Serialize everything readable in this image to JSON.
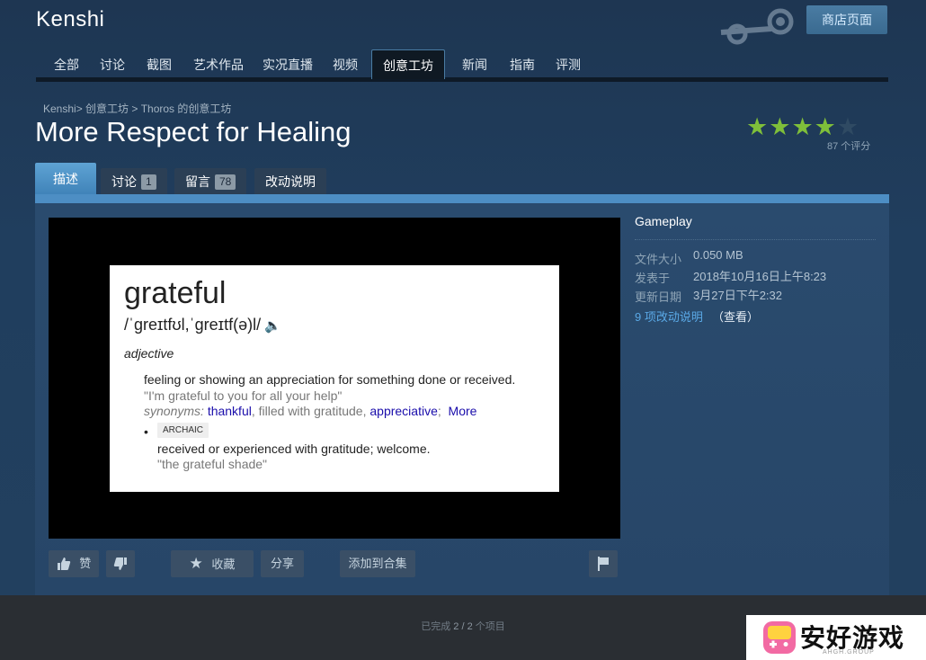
{
  "header": {
    "app_title": "Kenshi",
    "store_button": "商店页面"
  },
  "nav": {
    "items": [
      "全部",
      "讨论",
      "截图",
      "艺术作品",
      "实况直播",
      "视频",
      "创意工坊",
      "新闻",
      "指南",
      "评测"
    ],
    "active": "创意工坊"
  },
  "breadcrumb": "Kenshi>  创意工坊 > Thoros 的创意工坊",
  "page_title": "More Respect for Healing",
  "rating": {
    "stars_filled": 4,
    "stars_total": 5,
    "count_label": "87 个评分",
    "color_on": "#7fbf3a"
  },
  "tabs": {
    "description": "描述",
    "discussions": "讨论",
    "discussions_count": "1",
    "comments": "留言",
    "comments_count": "78",
    "changelog": "改动说明"
  },
  "preview": {
    "word": "grateful",
    "pronunciation": "/ˈɡreɪtfʊl,ˈɡreɪtf(ə)l/",
    "speaker_icon": "🔈",
    "part_of_speech": "adjective",
    "definition": "feeling or showing an appreciation for something done or received.",
    "example": "\"I'm grateful to you for all your help\"",
    "synonyms_label": "synonyms:",
    "synonym_1": "thankful",
    "synonym_plain": ", filled with gratitude, ",
    "synonym_2": "appreciative",
    "synonym_sep": ";",
    "synonym_more": "More",
    "bullet": "•",
    "tag": "ARCHAIC",
    "definition_2": "received or experienced with gratitude; welcome.",
    "example_2": "\"the grateful shade\""
  },
  "actions": {
    "like": "赞",
    "favorite": "收藏",
    "share": "分享",
    "add_to_collection": "添加到合集"
  },
  "sidebar": {
    "category": "Gameplay",
    "file_size_label": "文件大小",
    "file_size_value": "0.050 MB",
    "posted_label": "发表于",
    "posted_value": "2018年10月16日上午8:23",
    "updated_label": "更新日期",
    "updated_value": "3月27日下午2:32",
    "change_notes_link": "9 项改动说明",
    "change_notes_view": "（查看）"
  },
  "footer": {
    "status_prefix": "已完成",
    "status_count": "2 / 2",
    "status_suffix": "个项目"
  },
  "watermark": {
    "text": "安好游戏",
    "sub": "AHGH.GROUP"
  }
}
